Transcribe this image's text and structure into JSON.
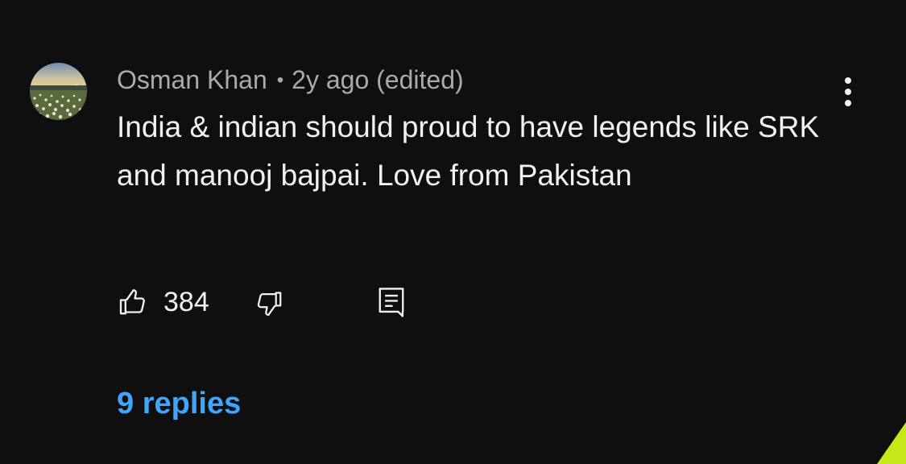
{
  "comment": {
    "author": "Osman Khan",
    "separator": "•",
    "time": "2y ago (edited)",
    "text": "India & indian should proud to have legends like SRK and manooj bajpai. Love from Pakistan",
    "like_count": "384",
    "replies_label": "9 replies"
  },
  "icons": {
    "avatar": "avatar",
    "menu": "more-vertical-icon",
    "like": "thumbs-up-icon",
    "dislike": "thumbs-down-icon",
    "reply": "comment-reply-icon"
  },
  "colors": {
    "background": "#0f0f0f",
    "text": "#f1f1f1",
    "meta_text": "#aaaaaa",
    "link": "#3ea6ff",
    "accent_corner": "#c6e818"
  }
}
